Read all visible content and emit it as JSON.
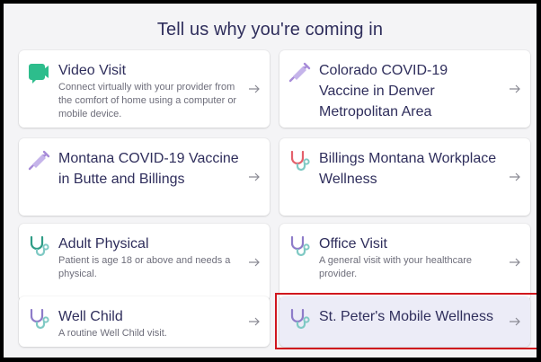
{
  "page_title": "Tell us why you're coming in",
  "colors": {
    "title": "#2f2e5c",
    "desc": "#6d6d7a",
    "video_icon": "#2dbd8c",
    "syringe_icon": "#a78bd8",
    "stethoscope_tube": "#7fc9c4",
    "stethoscope_red": "#e4606b",
    "stethoscope_purple": "#8e7cc9",
    "highlight": "#d0171e"
  },
  "cards": [
    {
      "icon": "video-camera-icon",
      "label": "Video Visit",
      "desc": "Connect virtually with your provider from the comfort of home using a computer or mobile device."
    },
    {
      "icon": "syringe-icon",
      "label": "Colorado COVID-19 Vaccine in Denver Metropolitan Area",
      "desc": ""
    },
    {
      "icon": "syringe-icon",
      "label": "Montana COVID-19 Vaccine in Butte and Billings",
      "desc": ""
    },
    {
      "icon": "stethoscope-icon",
      "label": "Billings Montana Workplace Wellness",
      "desc": ""
    },
    {
      "icon": "stethoscope-icon",
      "label": "Adult Physical",
      "desc": "Patient is age 18 or above and needs a physical."
    },
    {
      "icon": "stethoscope-icon",
      "label": "Office Visit",
      "desc": "A general visit with your healthcare provider."
    },
    {
      "icon": "stethoscope-icon",
      "label": "Well Child",
      "desc": "A routine Well Child visit."
    },
    {
      "icon": "stethoscope-icon",
      "label": "St. Peter's Mobile Wellness",
      "desc": ""
    }
  ]
}
